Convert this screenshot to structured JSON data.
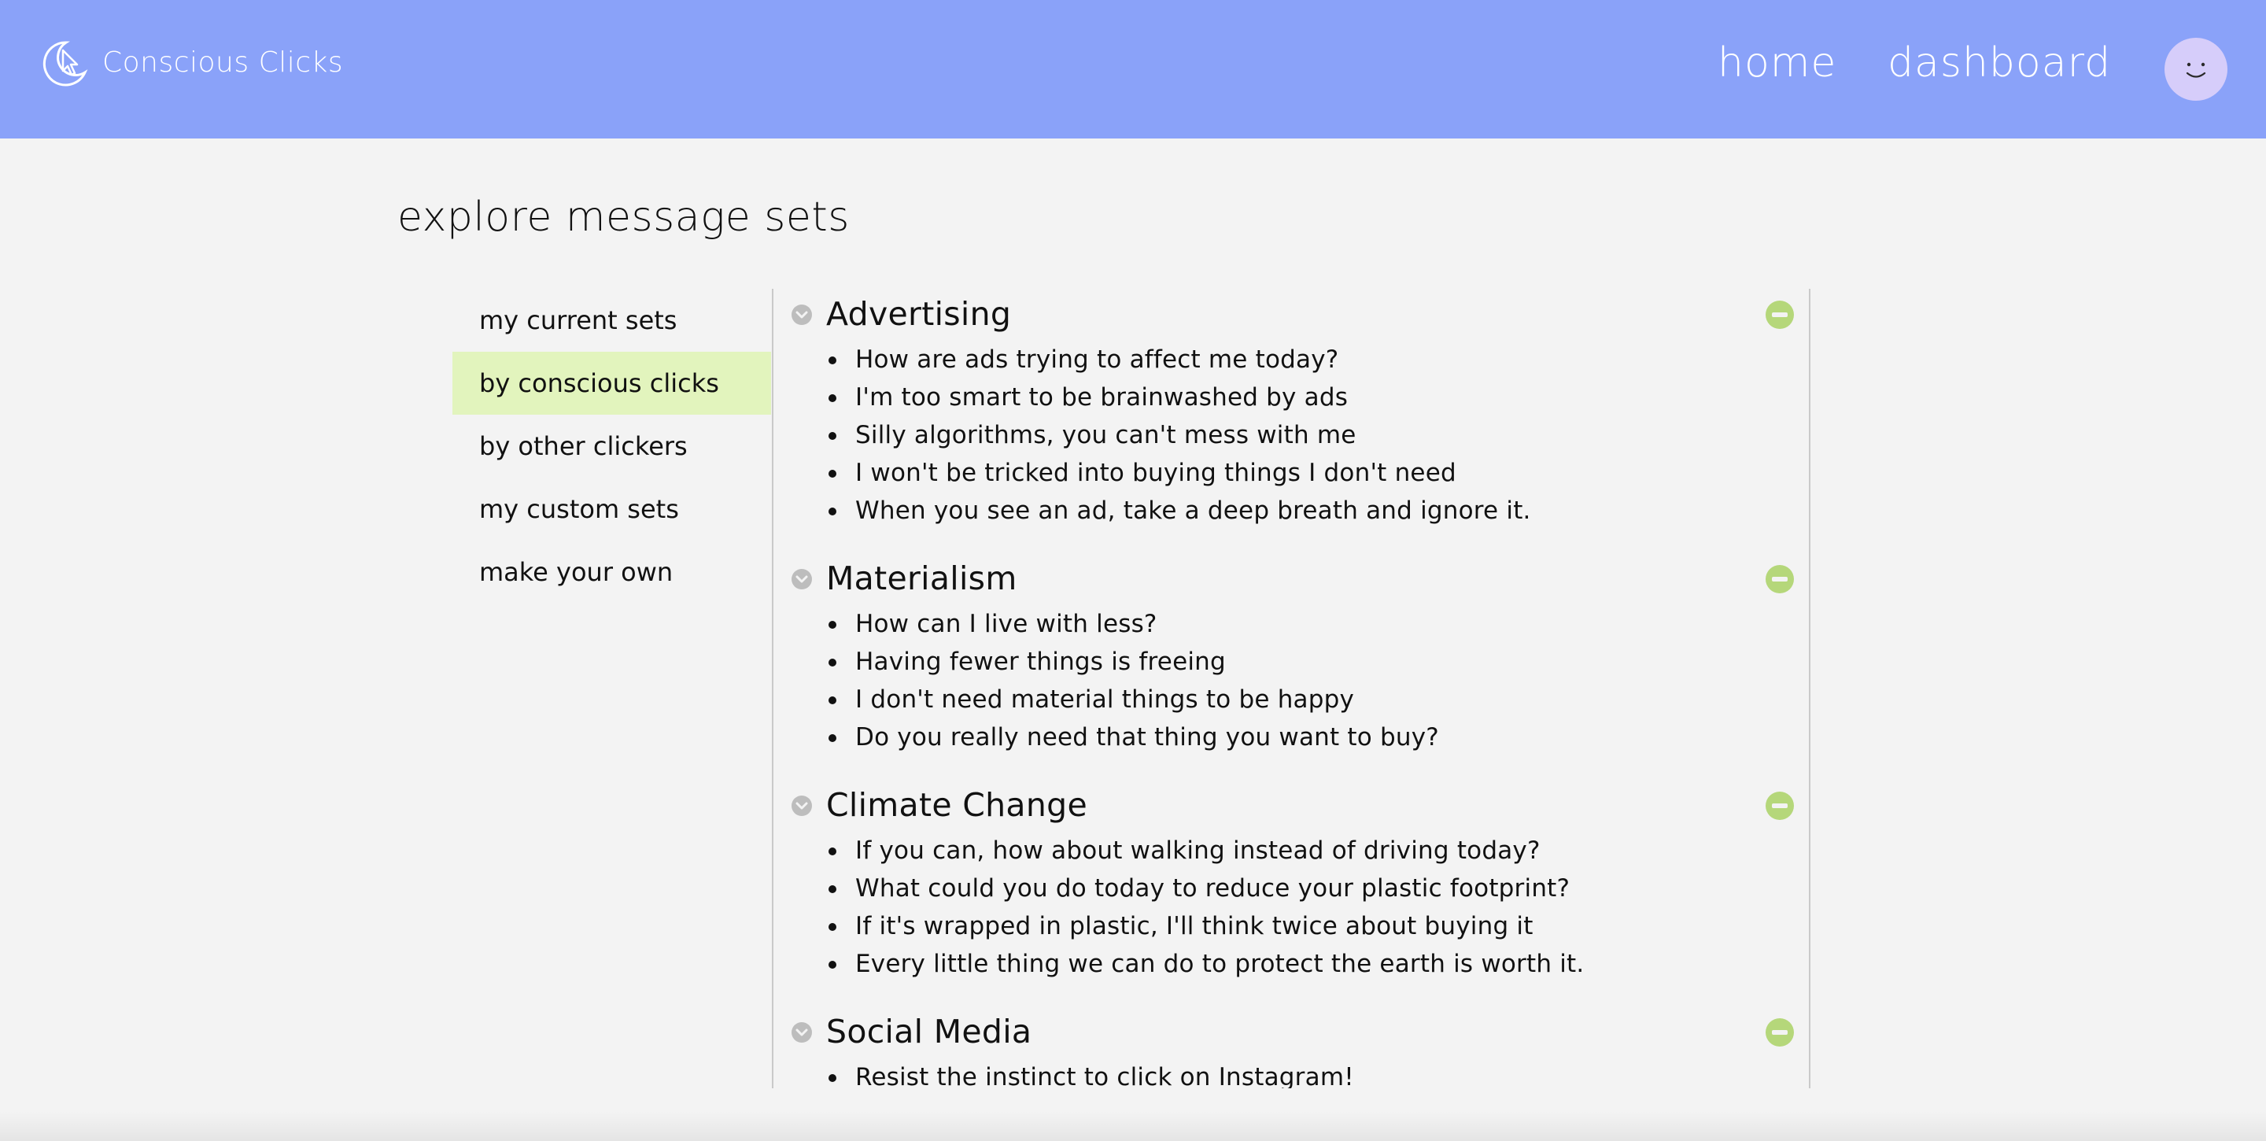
{
  "header": {
    "logo_text": "Conscious Clicks",
    "logo_icon": "moon-cursor-icon",
    "nav": {
      "home": "home",
      "dashboard": "dashboard"
    },
    "avatar_icon": "smiley-avatar-icon",
    "background": "#8aa2f9"
  },
  "page": {
    "title": "explore message sets"
  },
  "side_menu": {
    "active_index": 1,
    "active_color": "#e2f4bd",
    "items": [
      {
        "label": "my current sets"
      },
      {
        "label": "by conscious clicks"
      },
      {
        "label": "by other clickers"
      },
      {
        "label": "my custom sets"
      },
      {
        "label": "make your own"
      }
    ]
  },
  "sets": [
    {
      "title": "Advertising",
      "messages": [
        "How are ads trying to affect me today?",
        "I'm too smart to be brainwashed by ads",
        "Silly algorithms, you can't mess with me",
        "I won't be tricked into buying things I don't need",
        "When you see an ad, take a deep breath and ignore it."
      ]
    },
    {
      "title": "Materialism",
      "messages": [
        "How can I live with less?",
        "Having fewer things is freeing",
        "I don't need material things to be happy",
        "Do you really need that thing you want to buy?"
      ]
    },
    {
      "title": "Climate Change",
      "messages": [
        "If you can, how about walking instead of driving today?",
        "What could you do today to reduce your plastic footprint?",
        "If it's wrapped in plastic, I'll think twice about buying it",
        "Every little thing we can do to protect the earth is worth it."
      ]
    },
    {
      "title": "Social Media",
      "messages": [
        "Resist the instinct to click on Instagram!"
      ]
    }
  ],
  "icons": {
    "expand": "chevron-down-circle-icon",
    "remove": "minus-circle-icon",
    "remove_color": "#b5d77a",
    "expand_color": "#bdbdbd"
  }
}
